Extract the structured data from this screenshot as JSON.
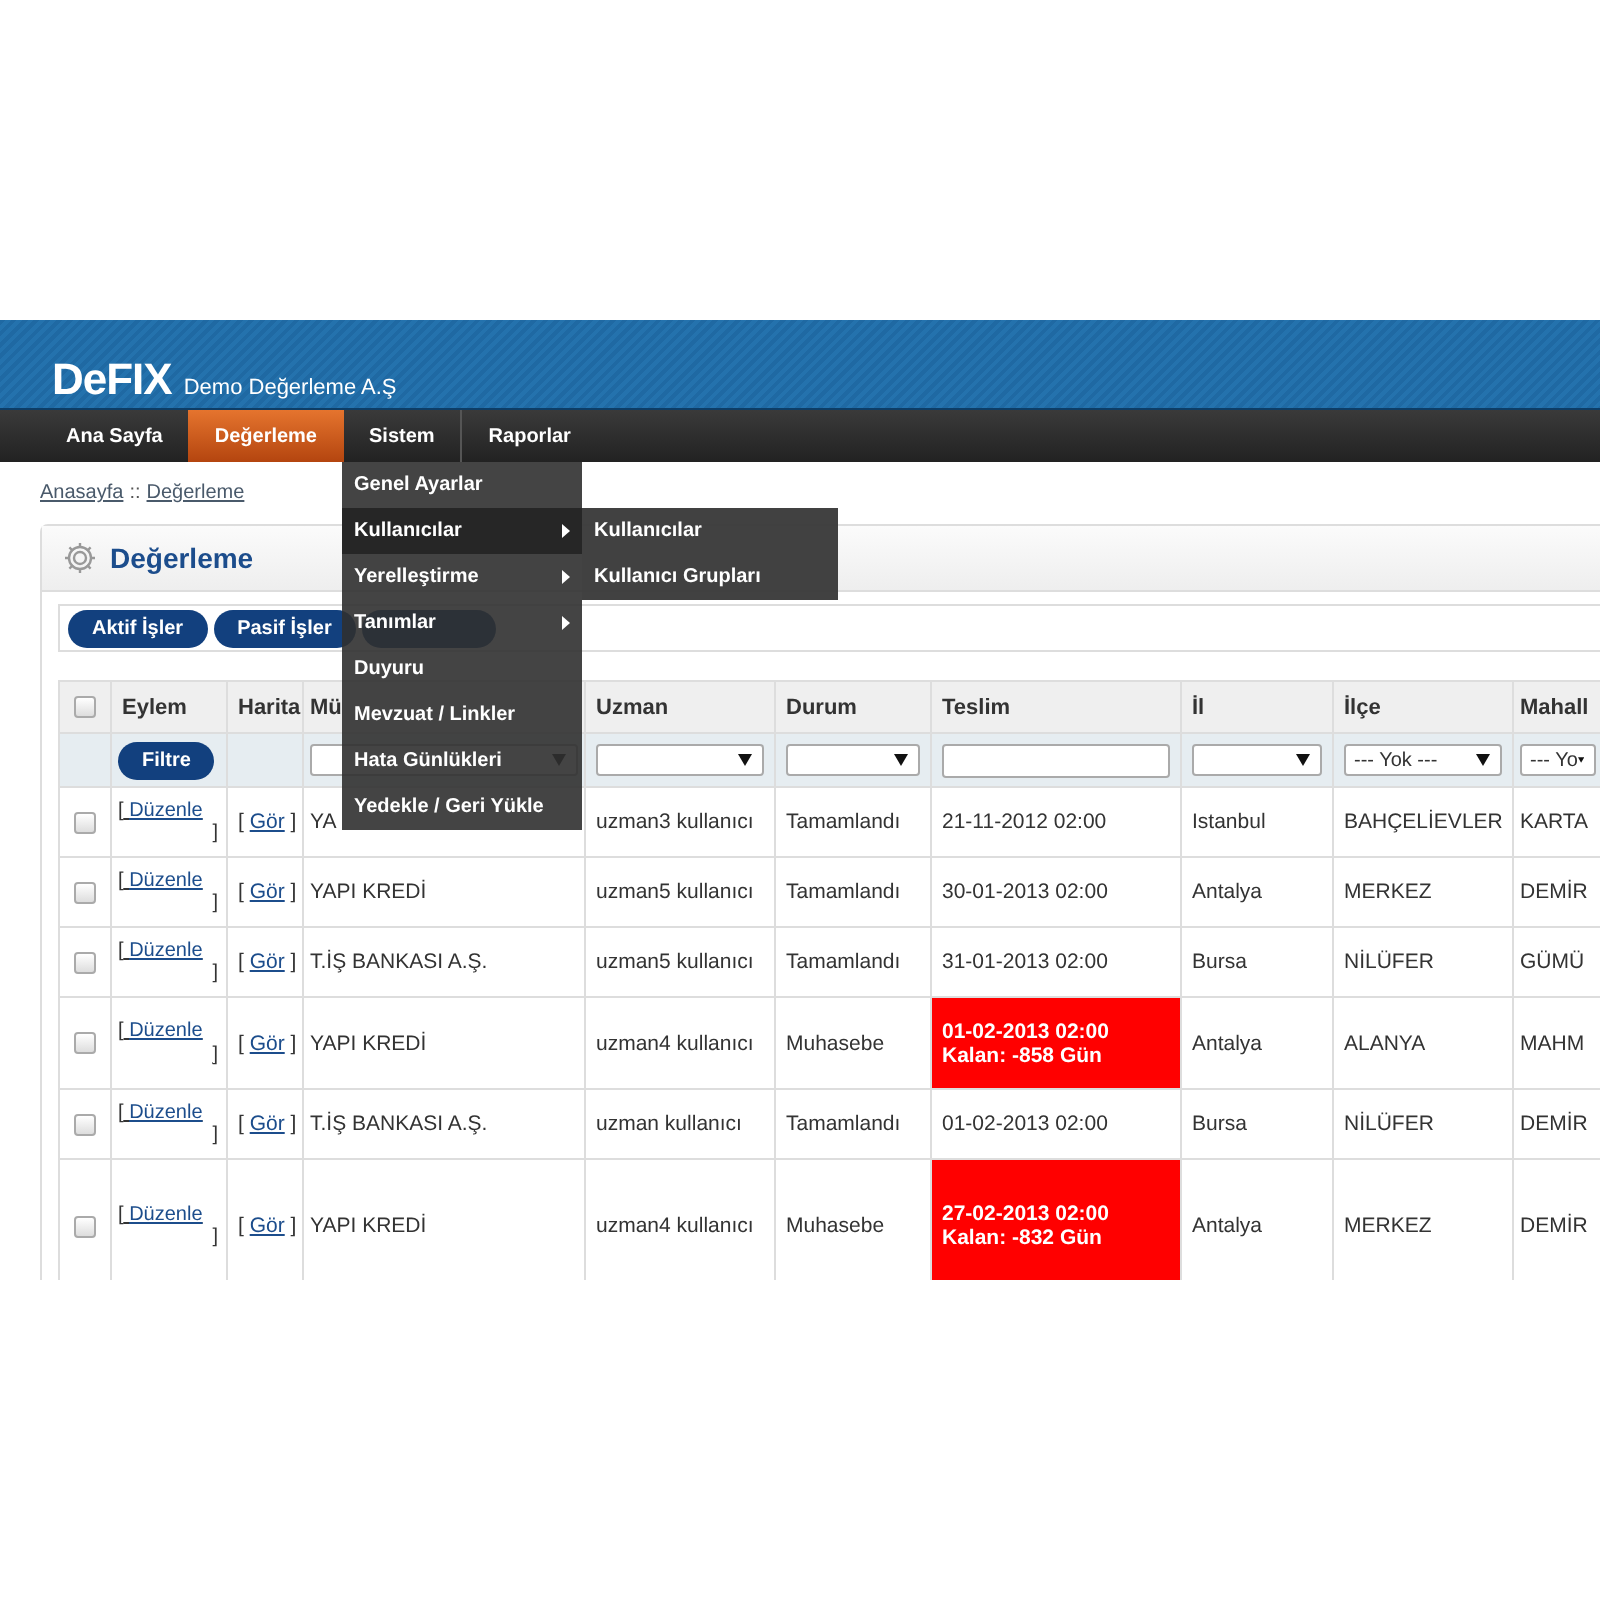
{
  "header": {
    "logo": "DeFIX",
    "company": "Demo Değerleme A.Ş"
  },
  "nav": {
    "items": [
      {
        "label": "Ana Sayfa",
        "selected": false
      },
      {
        "label": "Değerleme",
        "selected": true
      },
      {
        "label": "Sistem",
        "selected": false
      },
      {
        "label": "Raporlar",
        "selected": false
      }
    ]
  },
  "menu": {
    "items": [
      {
        "label": "Genel Ayarlar",
        "kind": "item",
        "selected": false
      },
      {
        "label": "Kullanıcılar",
        "kind": "submenu",
        "selected": true
      },
      {
        "label": "Yerelleştirme",
        "kind": "submenu",
        "selected": false
      },
      {
        "label": "Tanımlar",
        "kind": "submenu",
        "selected": false
      },
      {
        "label": "Duyuru",
        "kind": "item",
        "selected": false
      },
      {
        "label": "Mevzuat / Linkler",
        "kind": "item",
        "selected": false
      },
      {
        "label": "Hata Günlükleri",
        "kind": "item",
        "selected": false
      },
      {
        "label": "Yedekle / Geri Yükle",
        "kind": "item",
        "selected": false
      }
    ]
  },
  "submenu": {
    "items": [
      {
        "label": "Kullanıcılar"
      },
      {
        "label": "Kullanıcı Grupları"
      }
    ]
  },
  "breadcrumb": {
    "items": [
      {
        "label": "Anasayfa"
      },
      {
        "label": "Değerleme"
      }
    ],
    "separator": "::"
  },
  "panel": {
    "title": "Değerleme",
    "buttons": [
      {
        "kind": "labeled",
        "label": "Aktif İşler"
      },
      {
        "kind": "labeled",
        "label": "Pasif İşler"
      },
      {
        "kind": "obscured"
      }
    ]
  },
  "table": {
    "header_checkbox": {
      "checked": false
    },
    "columns": [
      "Eylem",
      "Harita",
      "Mü",
      "Uzman",
      "Durum",
      "Teslim",
      "İl",
      "İlçe",
      "Mahall"
    ],
    "filters": [
      {
        "kind": "button",
        "label": "Filtre"
      },
      {
        "kind": "none"
      },
      {
        "kind": "select"
      },
      {
        "kind": "select"
      },
      {
        "kind": "select"
      },
      {
        "kind": "input"
      },
      {
        "kind": "select"
      },
      {
        "kind": "select",
        "value": "--- Yok ---"
      },
      {
        "kind": "select",
        "value": "--- Yo"
      }
    ],
    "rows": [
      {
        "checked": false,
        "edit": [
          "[",
          "Düzenle",
          "]"
        ],
        "view": [
          "[",
          "Gör",
          "]"
        ],
        "musteri": "YA",
        "uzman": "uzman3 kullanıcı",
        "durum": "Tamamlandı",
        "teslim": {
          "date": "21-11-2012 02:00",
          "overdue": false
        },
        "il": "Istanbul",
        "ilce": "BAHÇELİEVLER",
        "mahalle": "KARTA"
      },
      {
        "checked": false,
        "edit": [
          "[",
          "Düzenle",
          "]"
        ],
        "view": [
          "[",
          "Gör",
          "]"
        ],
        "musteri": "YAPI KREDİ",
        "uzman": "uzman5 kullanıcı",
        "durum": "Tamamlandı",
        "teslim": {
          "date": "30-01-2013 02:00",
          "overdue": false
        },
        "il": "Antalya",
        "ilce": "MERKEZ",
        "mahalle": "DEMİR"
      },
      {
        "checked": false,
        "edit": [
          "[",
          "Düzenle",
          "]"
        ],
        "view": [
          "[",
          "Gör",
          "]"
        ],
        "musteri": "T.İŞ BANKASI A.Ş.",
        "uzman": "uzman5 kullanıcı",
        "durum": "Tamamlandı",
        "teslim": {
          "date": "31-01-2013 02:00",
          "overdue": false
        },
        "il": "Bursa",
        "ilce": "NİLÜFER",
        "mahalle": "GÜMÜ"
      },
      {
        "checked": false,
        "edit": [
          "[",
          "Düzenle",
          "]"
        ],
        "view": [
          "[",
          "Gör",
          "]"
        ],
        "musteri": "YAPI KREDİ",
        "uzman": "uzman4 kullanıcı",
        "durum": "Muhasebe",
        "teslim": {
          "date": "01-02-2013 02:00",
          "remaining": "Kalan: -858 Gün",
          "overdue": true
        },
        "il": "Antalya",
        "ilce": "ALANYA",
        "mahalle": "MAHM"
      },
      {
        "checked": false,
        "edit": [
          "[",
          "Düzenle",
          "]"
        ],
        "view": [
          "[",
          "Gör",
          "]"
        ],
        "musteri": "T.İŞ BANKASI A.Ş.",
        "uzman": "uzman kullanıcı",
        "durum": "Tamamlandı",
        "teslim": {
          "date": "01-02-2013 02:00",
          "overdue": false
        },
        "il": "Bursa",
        "ilce": "NİLÜFER",
        "mahalle": "DEMİR"
      },
      {
        "checked": false,
        "edit": [
          "[",
          "Düzenle",
          "]"
        ],
        "view": [
          "[",
          "Gör",
          "]"
        ],
        "musteri": "YAPI KREDİ",
        "uzman": "uzman4 kullanıcı",
        "durum": "Muhasebe",
        "teslim": {
          "date": "27-02-2013 02:00",
          "remaining": "Kalan: -832 Gün",
          "overdue": true
        },
        "il": "Antalya",
        "ilce": "MERKEZ",
        "mahalle": "DEMİR"
      }
    ]
  }
}
